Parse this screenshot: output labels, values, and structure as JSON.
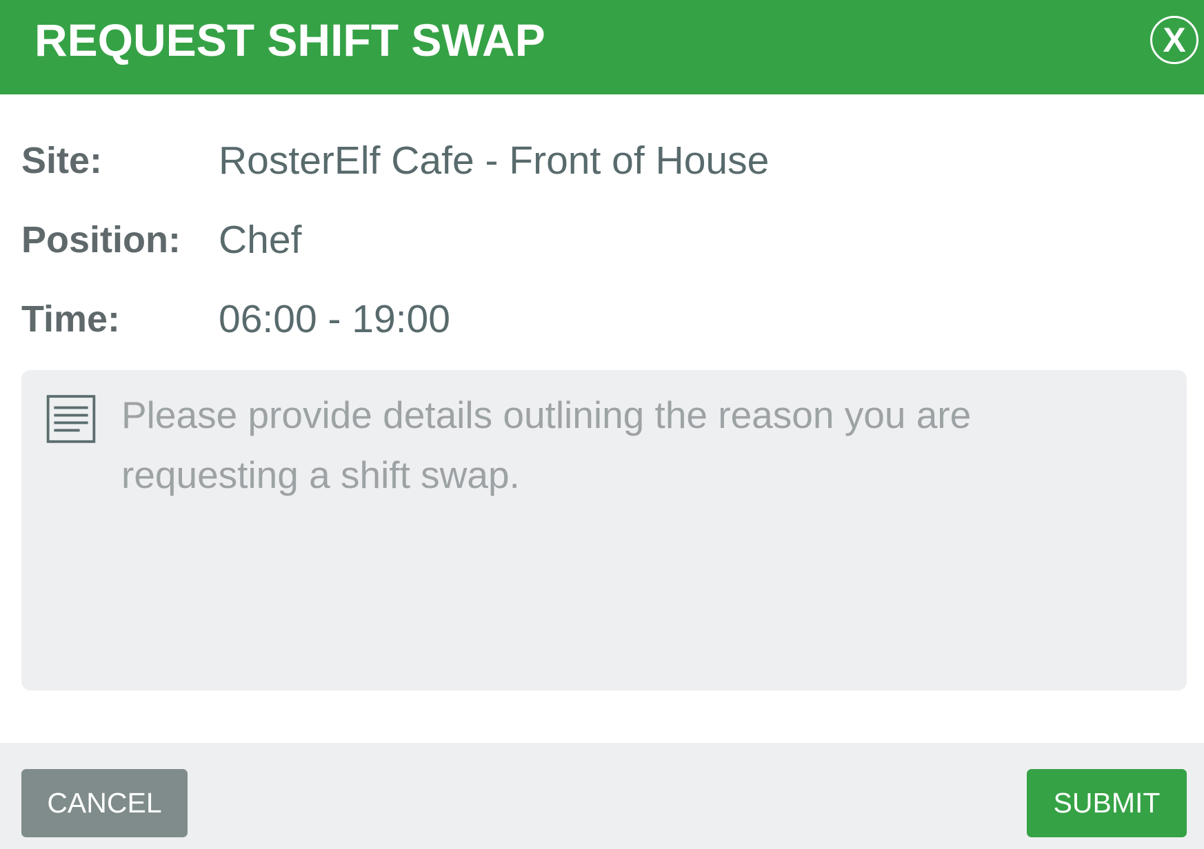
{
  "dialog": {
    "title": "REQUEST SHIFT SWAP",
    "close_label": "X",
    "close_icon": "close-circle-icon"
  },
  "details": [
    {
      "label": "Site:",
      "value": "RosterElf Cafe - Front of House"
    },
    {
      "label": "Position:",
      "value": "Chef"
    },
    {
      "label": "Time:",
      "value": "06:00 - 19:00"
    }
  ],
  "reason": {
    "icon": "notes-icon",
    "placeholder": "Please provide details outlining the reason you are requesting a shift swap."
  },
  "footer": {
    "cancel_label": "CANCEL",
    "submit_label": "SUBMIT"
  },
  "colors": {
    "header_bg": "#36a246",
    "submit_bg": "#35a245",
    "cancel_bg": "#7f8c8b",
    "panel_bg": "#eeeff1",
    "label_text": "#5f696b",
    "value_text": "#586a6c",
    "placeholder_text": "#9da2a5"
  }
}
